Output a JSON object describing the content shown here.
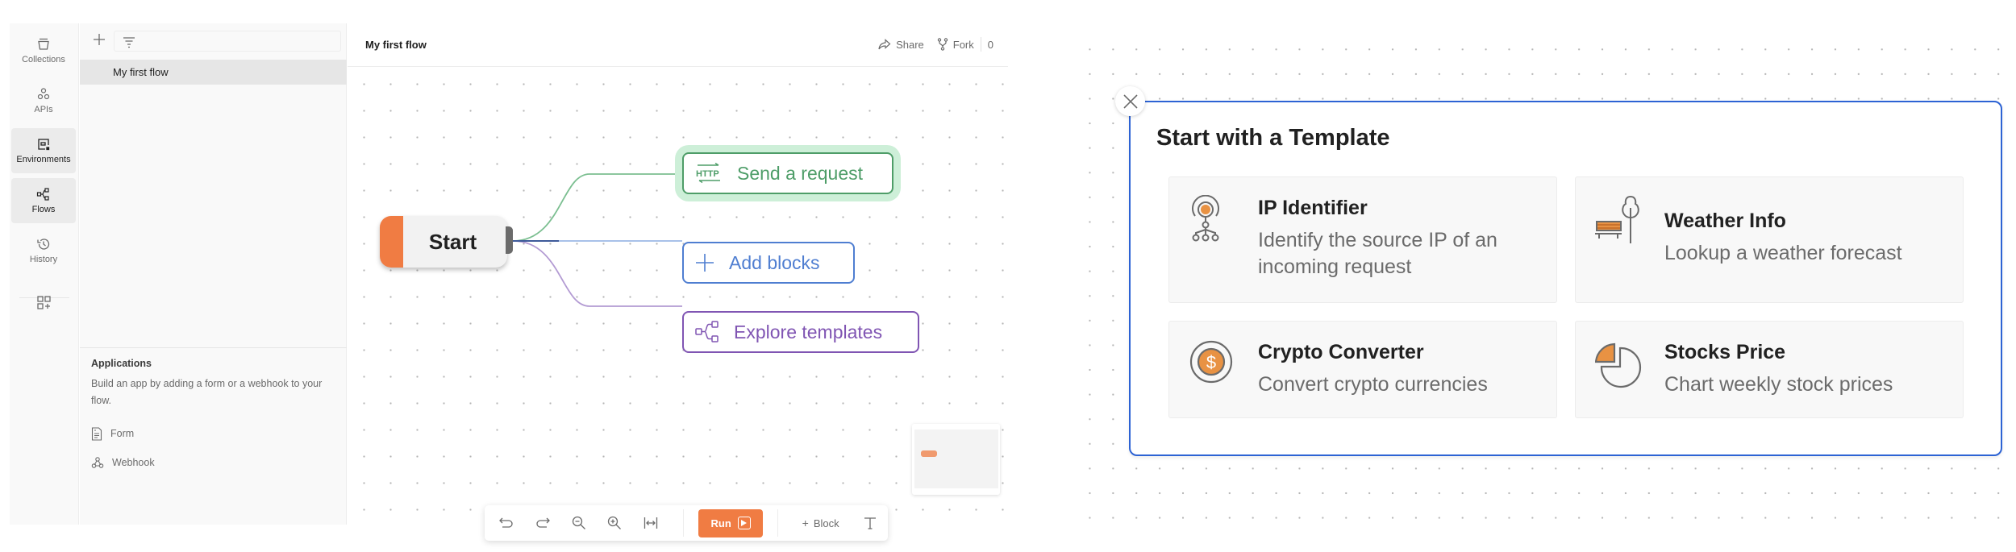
{
  "rail": {
    "items": [
      {
        "label": "Collections",
        "icon": "collections-icon",
        "active": false
      },
      {
        "label": "APIs",
        "icon": "apis-icon",
        "active": false
      },
      {
        "label": "Environments",
        "icon": "environments-icon",
        "active": true
      },
      {
        "label": "Flows",
        "icon": "flows-icon",
        "active": true
      },
      {
        "label": "History",
        "icon": "history-icon",
        "active": false
      }
    ],
    "extra_icon": "add-widget-icon"
  },
  "sidebar": {
    "new_icon": "plus-icon",
    "filter_icon": "filter-icon",
    "filter_placeholder": "",
    "items": [
      {
        "label": "My first flow",
        "selected": true
      }
    ],
    "applications": {
      "title": "Applications",
      "description": "Build an app by adding a form or a webhook to your flow.",
      "links": [
        {
          "label": "Form",
          "icon": "form-icon"
        },
        {
          "label": "Webhook",
          "icon": "webhook-icon"
        }
      ]
    }
  },
  "header": {
    "title": "My first flow",
    "share_label": "Share",
    "fork_label": "Fork",
    "fork_count": "0"
  },
  "canvas": {
    "start_node": {
      "label": "Start",
      "color": "#f07c43"
    },
    "actions": [
      {
        "label": "Send a request",
        "icon": "http-icon",
        "color": "#4e9d68",
        "highlight": "#cdefd8"
      },
      {
        "label": "Add blocks",
        "icon": "plus-icon",
        "color": "#4f7ed1"
      },
      {
        "label": "Explore templates",
        "icon": "flows-icon",
        "color": "#8055b3"
      }
    ]
  },
  "toolbar": {
    "undo_icon": "undo-icon",
    "redo_icon": "redo-icon",
    "zoom_out_icon": "zoom-out-icon",
    "zoom_in_icon": "zoom-in-icon",
    "fit_icon": "fit-width-icon",
    "run_label": "Run",
    "block_label": "Block",
    "text_icon": "text-icon"
  },
  "templates": {
    "title": "Start with a Template",
    "accent": "#2d63d4",
    "cards": [
      {
        "title": "IP Identifier",
        "description": "Identify the source IP of an incoming request",
        "icon": "ip-identifier-icon"
      },
      {
        "title": "Weather Info",
        "description": "Lookup a weather forecast",
        "icon": "weather-bench-tree-icon"
      },
      {
        "title": "Crypto Converter",
        "description": "Convert crypto currencies",
        "icon": "dollar-coin-icon"
      },
      {
        "title": "Stocks Price",
        "description": "Chart weekly stock prices",
        "icon": "pie-chart-icon"
      }
    ]
  }
}
